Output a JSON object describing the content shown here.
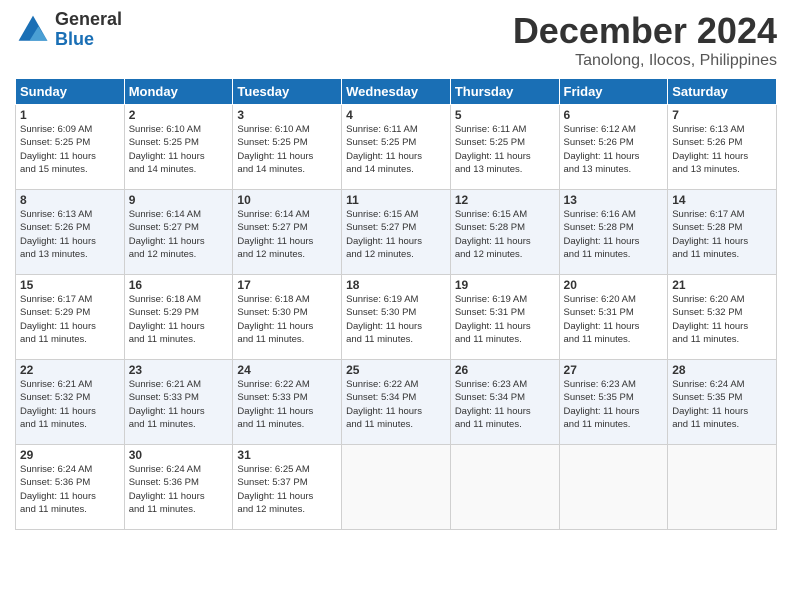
{
  "logo": {
    "general": "General",
    "blue": "Blue"
  },
  "header": {
    "month": "December 2024",
    "location": "Tanolong, Ilocos, Philippines"
  },
  "weekdays": [
    "Sunday",
    "Monday",
    "Tuesday",
    "Wednesday",
    "Thursday",
    "Friday",
    "Saturday"
  ],
  "weeks": [
    [
      {
        "day": "1",
        "sunrise": "6:09 AM",
        "sunset": "5:25 PM",
        "daylight": "11 hours and 15 minutes."
      },
      {
        "day": "2",
        "sunrise": "6:10 AM",
        "sunset": "5:25 PM",
        "daylight": "11 hours and 14 minutes."
      },
      {
        "day": "3",
        "sunrise": "6:10 AM",
        "sunset": "5:25 PM",
        "daylight": "11 hours and 14 minutes."
      },
      {
        "day": "4",
        "sunrise": "6:11 AM",
        "sunset": "5:25 PM",
        "daylight": "11 hours and 14 minutes."
      },
      {
        "day": "5",
        "sunrise": "6:11 AM",
        "sunset": "5:25 PM",
        "daylight": "11 hours and 13 minutes."
      },
      {
        "day": "6",
        "sunrise": "6:12 AM",
        "sunset": "5:26 PM",
        "daylight": "11 hours and 13 minutes."
      },
      {
        "day": "7",
        "sunrise": "6:13 AM",
        "sunset": "5:26 PM",
        "daylight": "11 hours and 13 minutes."
      }
    ],
    [
      {
        "day": "8",
        "sunrise": "6:13 AM",
        "sunset": "5:26 PM",
        "daylight": "11 hours and 13 minutes."
      },
      {
        "day": "9",
        "sunrise": "6:14 AM",
        "sunset": "5:27 PM",
        "daylight": "11 hours and 12 minutes."
      },
      {
        "day": "10",
        "sunrise": "6:14 AM",
        "sunset": "5:27 PM",
        "daylight": "11 hours and 12 minutes."
      },
      {
        "day": "11",
        "sunrise": "6:15 AM",
        "sunset": "5:27 PM",
        "daylight": "11 hours and 12 minutes."
      },
      {
        "day": "12",
        "sunrise": "6:15 AM",
        "sunset": "5:28 PM",
        "daylight": "11 hours and 12 minutes."
      },
      {
        "day": "13",
        "sunrise": "6:16 AM",
        "sunset": "5:28 PM",
        "daylight": "11 hours and 11 minutes."
      },
      {
        "day": "14",
        "sunrise": "6:17 AM",
        "sunset": "5:28 PM",
        "daylight": "11 hours and 11 minutes."
      }
    ],
    [
      {
        "day": "15",
        "sunrise": "6:17 AM",
        "sunset": "5:29 PM",
        "daylight": "11 hours and 11 minutes."
      },
      {
        "day": "16",
        "sunrise": "6:18 AM",
        "sunset": "5:29 PM",
        "daylight": "11 hours and 11 minutes."
      },
      {
        "day": "17",
        "sunrise": "6:18 AM",
        "sunset": "5:30 PM",
        "daylight": "11 hours and 11 minutes."
      },
      {
        "day": "18",
        "sunrise": "6:19 AM",
        "sunset": "5:30 PM",
        "daylight": "11 hours and 11 minutes."
      },
      {
        "day": "19",
        "sunrise": "6:19 AM",
        "sunset": "5:31 PM",
        "daylight": "11 hours and 11 minutes."
      },
      {
        "day": "20",
        "sunrise": "6:20 AM",
        "sunset": "5:31 PM",
        "daylight": "11 hours and 11 minutes."
      },
      {
        "day": "21",
        "sunrise": "6:20 AM",
        "sunset": "5:32 PM",
        "daylight": "11 hours and 11 minutes."
      }
    ],
    [
      {
        "day": "22",
        "sunrise": "6:21 AM",
        "sunset": "5:32 PM",
        "daylight": "11 hours and 11 minutes."
      },
      {
        "day": "23",
        "sunrise": "6:21 AM",
        "sunset": "5:33 PM",
        "daylight": "11 hours and 11 minutes."
      },
      {
        "day": "24",
        "sunrise": "6:22 AM",
        "sunset": "5:33 PM",
        "daylight": "11 hours and 11 minutes."
      },
      {
        "day": "25",
        "sunrise": "6:22 AM",
        "sunset": "5:34 PM",
        "daylight": "11 hours and 11 minutes."
      },
      {
        "day": "26",
        "sunrise": "6:23 AM",
        "sunset": "5:34 PM",
        "daylight": "11 hours and 11 minutes."
      },
      {
        "day": "27",
        "sunrise": "6:23 AM",
        "sunset": "5:35 PM",
        "daylight": "11 hours and 11 minutes."
      },
      {
        "day": "28",
        "sunrise": "6:24 AM",
        "sunset": "5:35 PM",
        "daylight": "11 hours and 11 minutes."
      }
    ],
    [
      {
        "day": "29",
        "sunrise": "6:24 AM",
        "sunset": "5:36 PM",
        "daylight": "11 hours and 11 minutes."
      },
      {
        "day": "30",
        "sunrise": "6:24 AM",
        "sunset": "5:36 PM",
        "daylight": "11 hours and 11 minutes."
      },
      {
        "day": "31",
        "sunrise": "6:25 AM",
        "sunset": "5:37 PM",
        "daylight": "11 hours and 12 minutes."
      },
      null,
      null,
      null,
      null
    ]
  ],
  "labels": {
    "sunrise": "Sunrise:",
    "sunset": "Sunset:",
    "daylight": "Daylight:"
  }
}
